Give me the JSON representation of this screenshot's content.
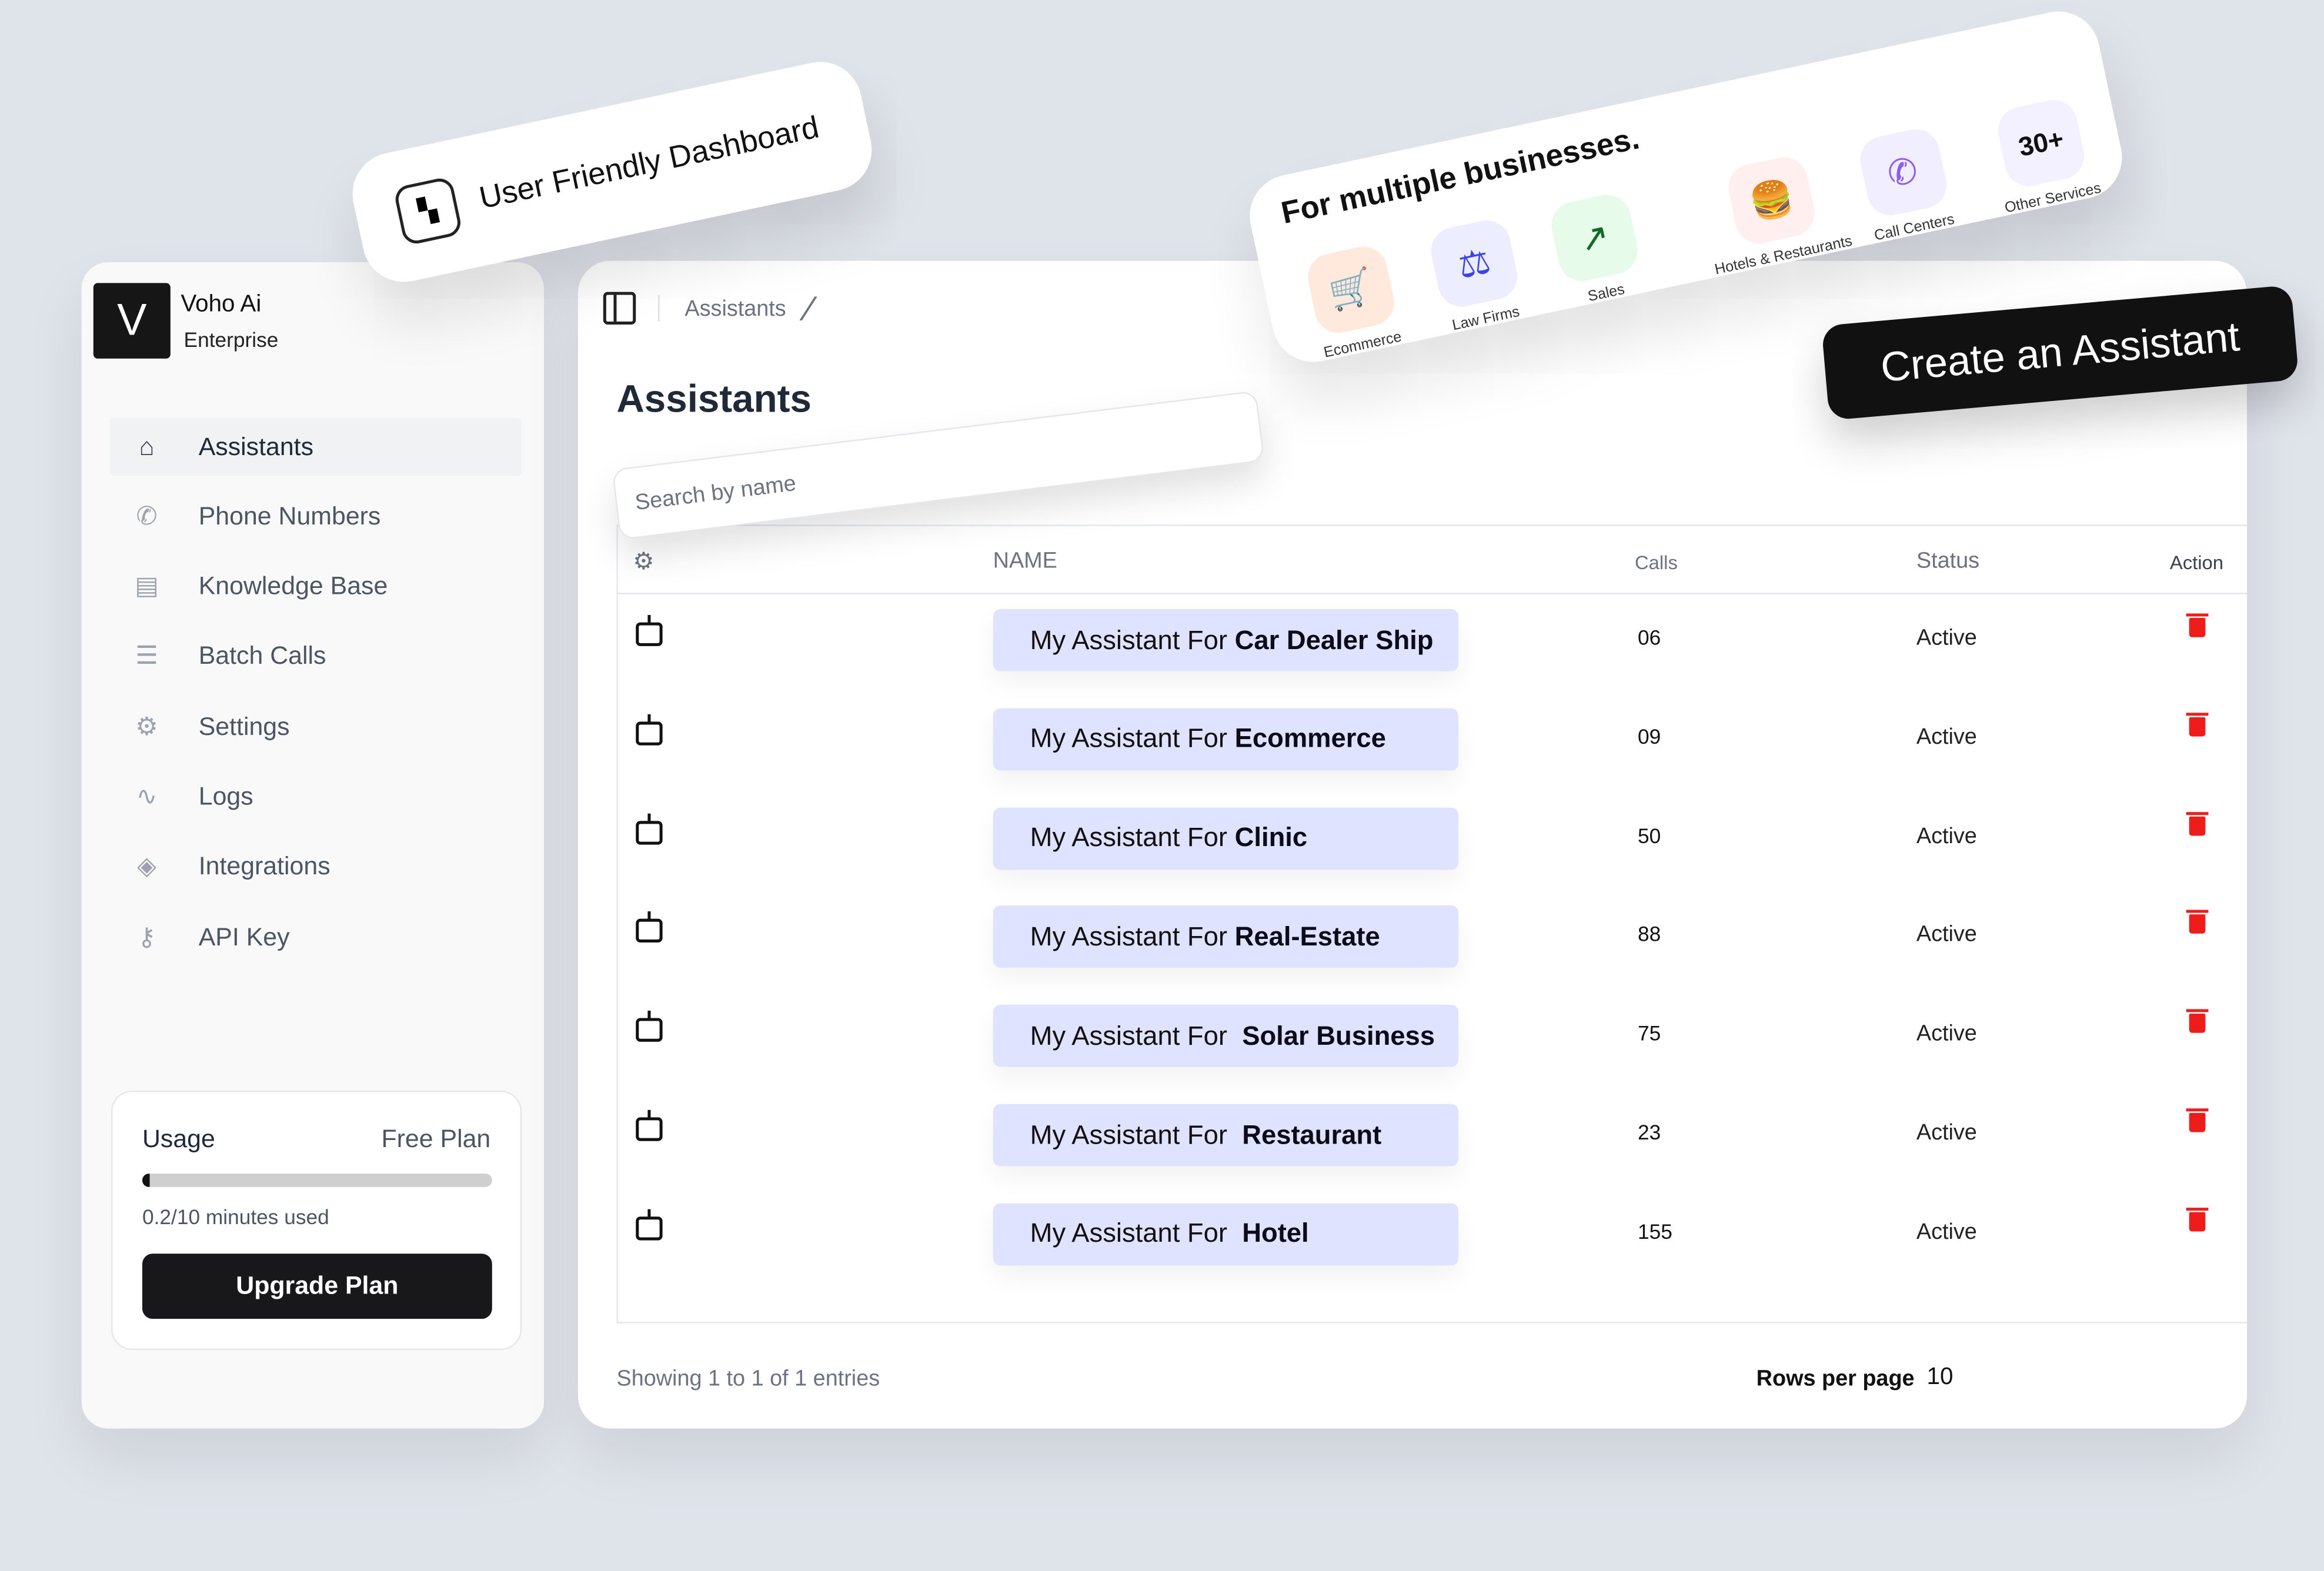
{
  "promo": {
    "dashboard_label": "User Friendly Dashboard",
    "businesses_title": "For multiple businesses.",
    "businesses": [
      {
        "label": "Ecommerce",
        "icon": "cart-icon",
        "bg": "#ffe9dd",
        "color": "#ff7a00"
      },
      {
        "label": "Law Firms",
        "icon": "scales-icon",
        "bg": "#eceeff",
        "color": "#3b44e6"
      },
      {
        "label": "Sales",
        "icon": "chart-up-icon",
        "bg": "#e6fbe9",
        "color": "#0b6b22"
      },
      {
        "label": "Hotels & Restaurants",
        "icon": "burger-drink-icon",
        "bg": "#ffefef",
        "color": "#f03030"
      },
      {
        "label": "Call Centers",
        "icon": "phone-call-icon",
        "bg": "#f1eeff",
        "color": "#8b5cf6"
      },
      {
        "label": "Other Services",
        "icon": "more-services",
        "bg": "#f3f1ff",
        "color": "#111",
        "badge": "30+"
      }
    ],
    "create_button": "Create an Assistant"
  },
  "sidebar": {
    "logo_letter": "V",
    "org_name": "Voho Ai",
    "plan_name": "Enterprise",
    "items": [
      {
        "label": "Assistants",
        "icon": "home-icon",
        "active": true
      },
      {
        "label": "Phone Numbers",
        "icon": "phone-icon"
      },
      {
        "label": "Knowledge Base",
        "icon": "document-icon"
      },
      {
        "label": "Batch Calls",
        "icon": "list-icon"
      },
      {
        "label": "Settings",
        "icon": "gear-icon"
      },
      {
        "label": "Logs",
        "icon": "activity-icon"
      },
      {
        "label": "Integrations",
        "icon": "layers-icon"
      },
      {
        "label": "API Key",
        "icon": "key-icon"
      }
    ],
    "usage": {
      "title": "Usage",
      "plan": "Free Plan",
      "used_fraction": 0.02,
      "text": "0.2/10 minutes used",
      "upgrade_label": "Upgrade Plan"
    }
  },
  "main": {
    "breadcrumb": "Assistants",
    "title": "Assistants",
    "search_placeholder": "Search by name",
    "columns": {
      "name": "NAME",
      "calls": "Calls",
      "status": "Status",
      "action": "Action"
    },
    "rows": [
      {
        "prefix": "My Assistant For ",
        "name": "Car Dealer Ship",
        "calls": "06",
        "status": "Active"
      },
      {
        "prefix": "My Assistant For ",
        "name": "Ecommerce",
        "calls": "09",
        "status": "Active"
      },
      {
        "prefix": "My Assistant For ",
        "name": "Clinic",
        "calls": "50",
        "status": "Active"
      },
      {
        "prefix": "My Assistant For ",
        "name": "Real-Estate",
        "calls": "88",
        "status": "Active"
      },
      {
        "prefix": "My Assistant For  ",
        "name": "Solar Business",
        "calls": "75",
        "status": "Active"
      },
      {
        "prefix": "My Assistant For  ",
        "name": "Restaurant",
        "calls": "23",
        "status": "Active"
      },
      {
        "prefix": "My Assistant For  ",
        "name": "Hotel",
        "calls": "155",
        "status": "Active"
      }
    ],
    "footer": {
      "showing": "Showing 1 to 1 of 1 entries",
      "rows_per_page_label": "Rows per page",
      "rows_per_page": "10"
    },
    "delete_color": "#ef1c1c"
  }
}
